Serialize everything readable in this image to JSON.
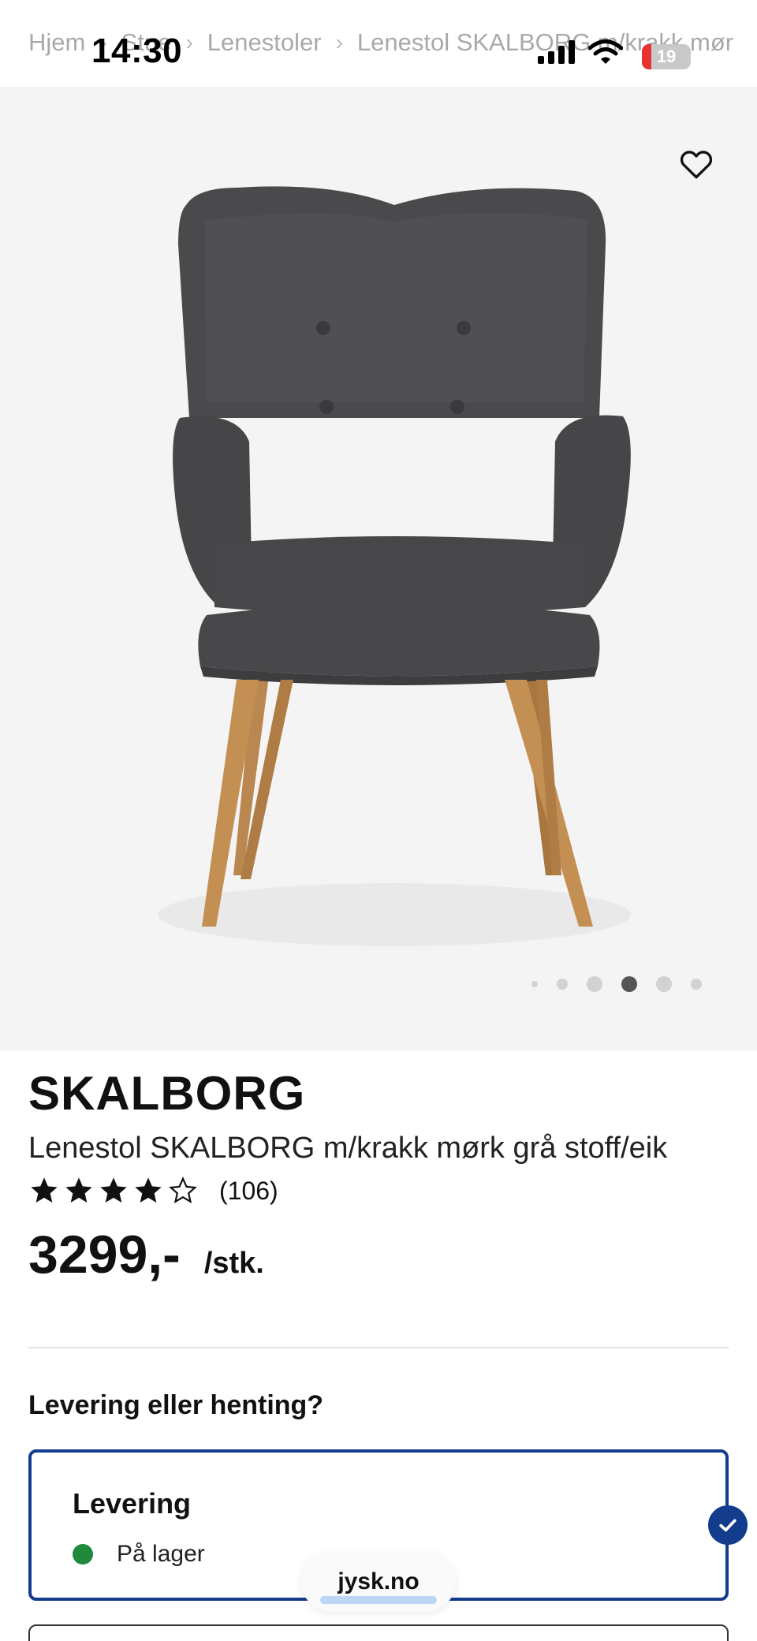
{
  "status_bar": {
    "time": "14:30",
    "battery": "19",
    "battery_level": 0.19
  },
  "breadcrumb": {
    "items": [
      "Hjem",
      "Stue",
      "Lenestoler",
      "Lenestol SKALBORG m/krakk mør"
    ]
  },
  "gallery": {
    "image_alt": "Lenestol SKALBORG m/krakk",
    "favorite_icon": "heart-outline-icon",
    "pagination_count": 6,
    "active_index": 3
  },
  "product": {
    "brand": "SKALBORG",
    "title": "Lenestol SKALBORG m/krakk mørk grå stoff/eik",
    "rating": 4,
    "rating_max": 5,
    "rating_count": "(106)",
    "price": "3299,-",
    "unit": "/stk."
  },
  "delivery": {
    "heading": "Levering eller henting?",
    "option_title": "Levering",
    "stock_status": "På lager",
    "stock_color": "#1f8a3c",
    "selected_color": "#143c8c"
  },
  "browser": {
    "url": "jysk.no"
  }
}
